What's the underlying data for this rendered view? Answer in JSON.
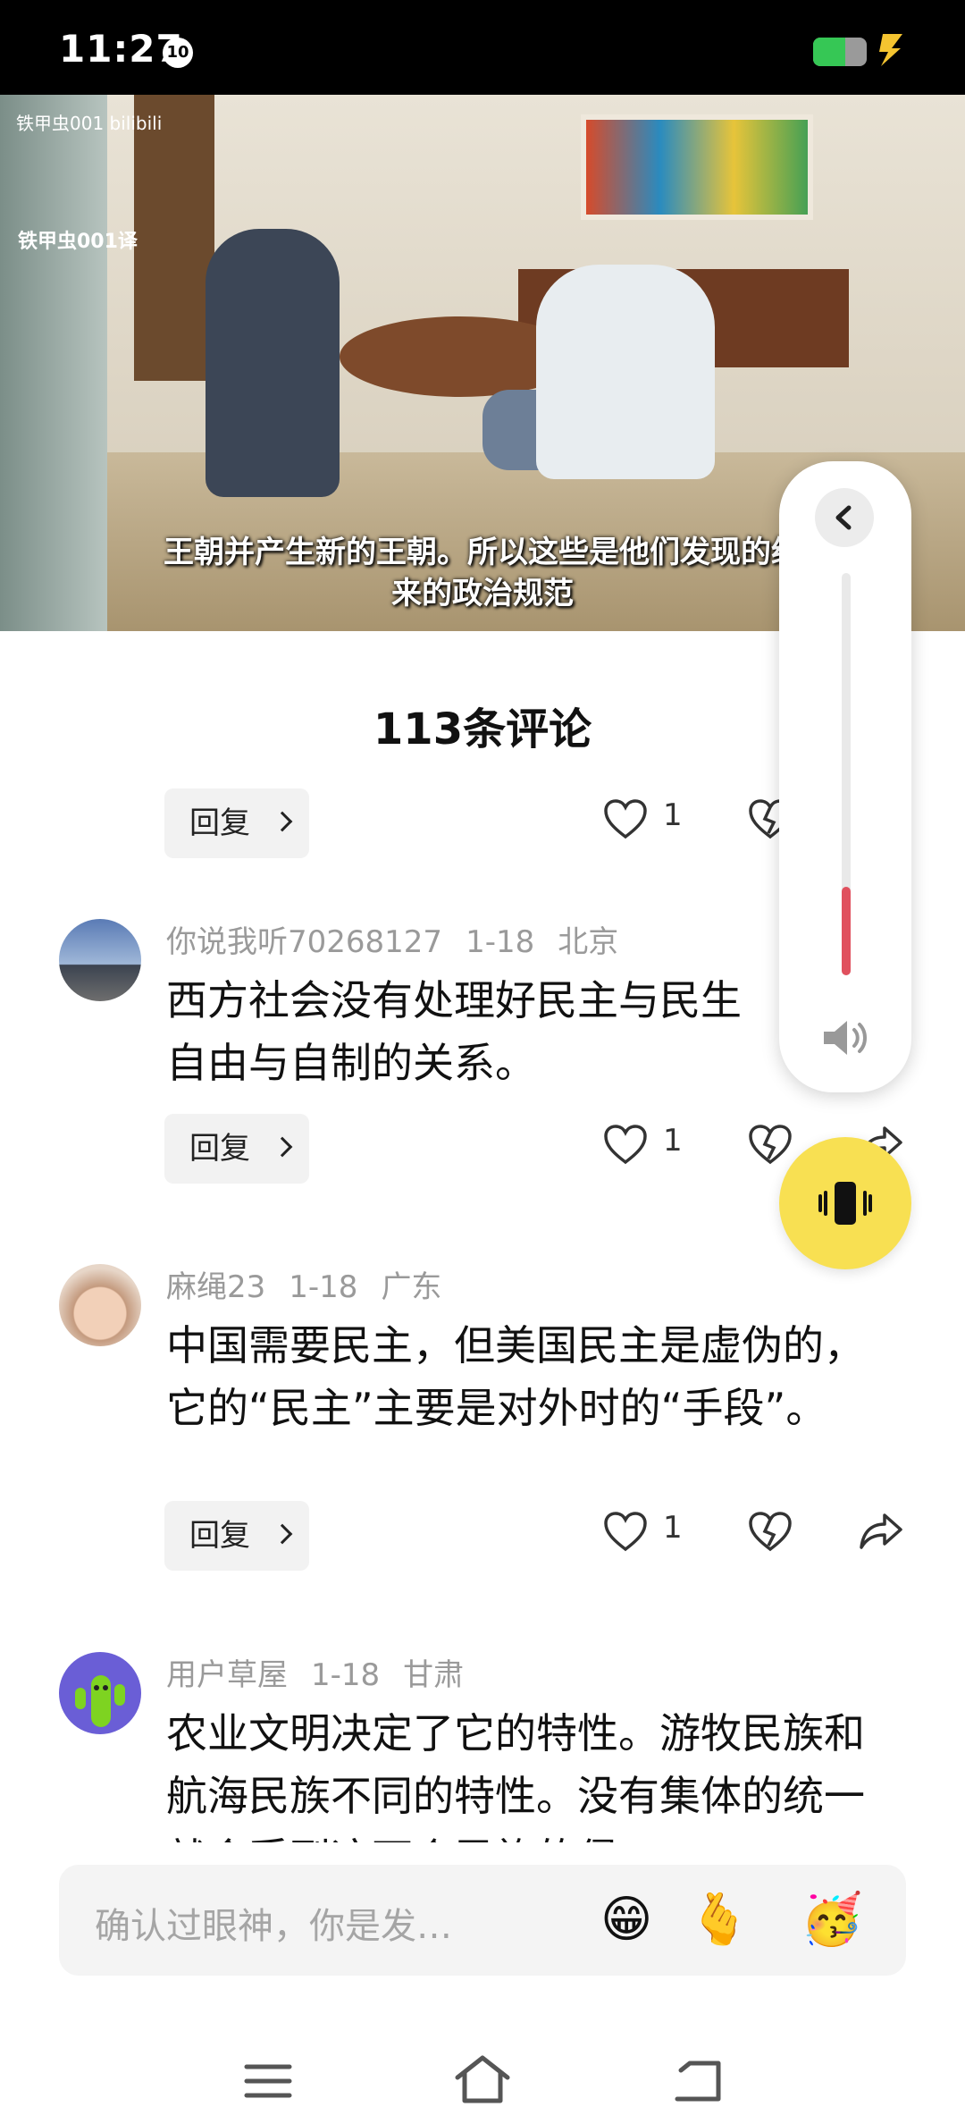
{
  "status_bar": {
    "time": "11:27",
    "notification_badge": "10",
    "battery_level": 0.6,
    "battery_color": "#36c755",
    "charging_icon": "bolt-icon"
  },
  "video": {
    "watermark_top": "铁甲虫001 bilibili",
    "watermark_left": "铁甲虫001译",
    "subtitle_line1": "王朝并产生新的王朝。所以这些是他们发现的统",
    "subtitle_line2": "来的政治规范"
  },
  "comments_sheet": {
    "title": "113条评论",
    "first_action_row": {
      "reply_label": "回复",
      "like_count": "1"
    },
    "comments": [
      {
        "username": "你说我听70268127",
        "date": "1-18",
        "location": "北京",
        "text": "西方社会没有处理好民主与民生\n自由与自制的关系。",
        "reply_label": "回复",
        "like_count": "1"
      },
      {
        "username": "麻绳23",
        "date": "1-18",
        "location": "广东",
        "text": "中国需要民主，但美国民主是虚伪的，它的“民主”主要是对外时的“手段”。",
        "reply_label": "回复",
        "like_count": "1"
      },
      {
        "username": "用户草屋",
        "date": "1-18",
        "location": "甘肃",
        "text": "农业文明决定了它的特性。游牧民族和航海民族不同的特性。没有集体的统一就会受到这两个民族的侵"
      }
    ]
  },
  "input_bar": {
    "placeholder": "确认过眼神，你是发…",
    "emojis": [
      "😁",
      "🫰",
      "🥳"
    ]
  },
  "volume_panel": {
    "level": 0.22,
    "accent_color": "#e0505e",
    "vibrate_button_color": "#f8e052"
  },
  "nav_bar": {
    "icons": [
      "menu-icon",
      "home-icon",
      "back-icon"
    ]
  }
}
